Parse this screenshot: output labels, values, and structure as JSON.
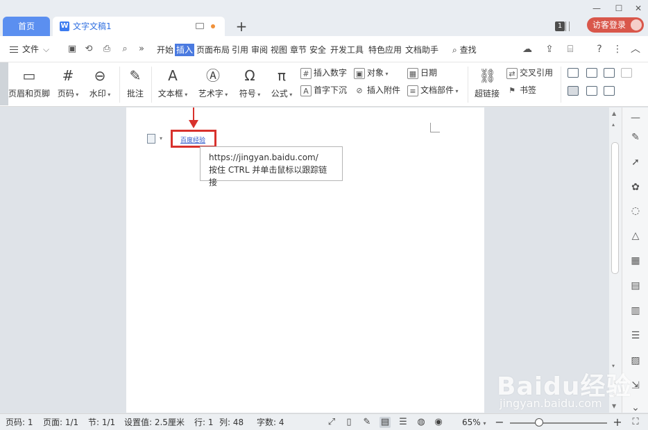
{
  "titlebar": {
    "home_tab": "首页",
    "doc_tab": "文字文稿1",
    "doc_tab_icon": "W",
    "add_tab": "+",
    "notification_count": "1",
    "guest_login": "访客登录",
    "min_icon": "—",
    "max_icon": "☐",
    "close_icon": "✕"
  },
  "menubar": {
    "file": "文件",
    "tabs": [
      "开始",
      "插入",
      "页面布局",
      "引用",
      "审阅",
      "视图",
      "章节",
      "安全",
      "开发工具",
      "特色应用",
      "文档助手"
    ],
    "active_tab": "插入",
    "search": "查找",
    "help": "?",
    "more": "⋮",
    "collapse": "︿",
    "more_chevron": "»"
  },
  "ribbon": {
    "header_footer": "页眉和页脚",
    "page_number": "页码",
    "watermark": "水印",
    "comment": "批注",
    "text_box": "文本框",
    "word_art": "艺术字",
    "symbol": "符号",
    "formula": "公式",
    "insert_number": "插入数字",
    "object": "对象",
    "date": "日期",
    "drop_cap": "首字下沉",
    "insert_attachment": "插入附件",
    "doc_parts": "文档部件",
    "hyperlink": "超链接",
    "cross_reference": "交叉引用",
    "bookmark": "书签"
  },
  "document": {
    "hyperlink_text": "百度经验",
    "tooltip_url": "https://jingyan.baidu.com/",
    "tooltip_hint": "按住 CTRL 并单击鼠标以跟踪链接"
  },
  "statusbar": {
    "page_number": "页码: 1",
    "pages": "页面: 1/1",
    "section": "节: 1/1",
    "setting": "设置值: 2.5厘米",
    "row": "行: 1",
    "column": "列: 48",
    "word_count": "字数: 4",
    "zoom": "65%"
  },
  "watermark": {
    "brand": "Baidu经验",
    "site": "jingyan.baidu.com"
  },
  "colors": {
    "accent": "#4a7ae0",
    "home_tab": "#5b8ff0",
    "guest_login": "#d9574b",
    "highlight_box": "#d8312c",
    "link": "#2f57c9"
  }
}
